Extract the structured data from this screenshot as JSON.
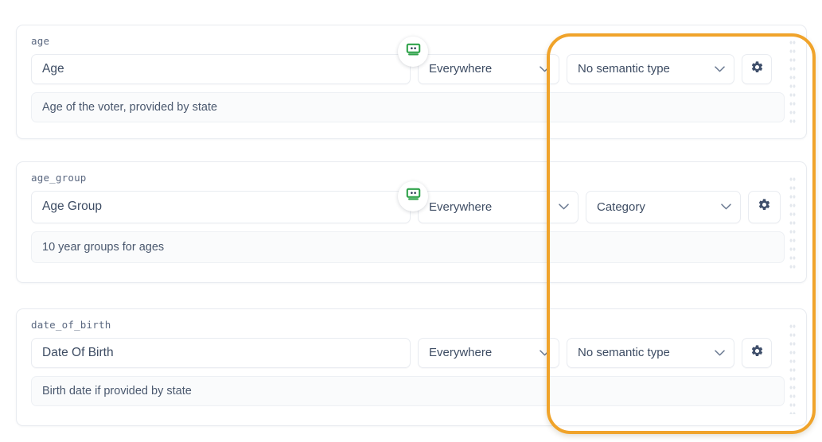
{
  "page": {
    "accent_orange": "#f0a32a",
    "text_color": "#3d4c63",
    "key_color": "#5b6880",
    "bot_green": "#2fa24a"
  },
  "icons": {
    "bot": "robot-head-icon",
    "gear": "gear-icon",
    "caret": "chevron-down-icon",
    "drag": "drag-handle-icon"
  },
  "fields": [
    {
      "key": "age",
      "display_name": "Age",
      "scope": "Everywhere",
      "semantic_type": "No semantic type",
      "description": "Age of the voter, provided by state",
      "has_bot_badge": true
    },
    {
      "key": "age_group",
      "display_name": "Age Group",
      "scope": "Everywhere",
      "semantic_type": "Category",
      "description": "10 year groups for ages",
      "has_bot_badge": true
    },
    {
      "key": "date_of_birth",
      "display_name": "Date Of Birth",
      "scope": "Everywhere",
      "semantic_type": "No semantic type",
      "description": "Birth date if provided by state",
      "has_bot_badge": false
    }
  ]
}
